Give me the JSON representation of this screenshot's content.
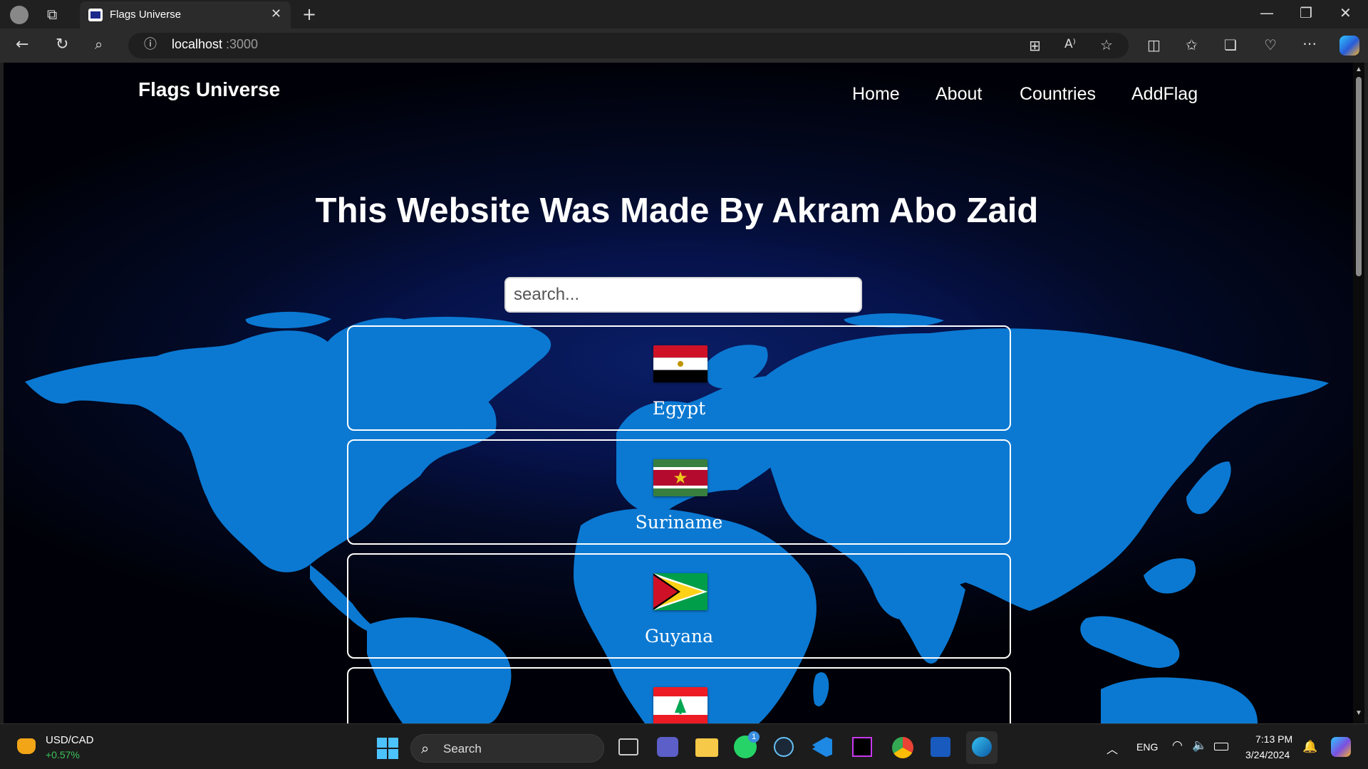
{
  "browser": {
    "tab_title": "Flags Universe",
    "url_host": "localhost",
    "url_port": ":3000"
  },
  "site": {
    "brand": "Flags Universe",
    "nav": [
      "Home",
      "About",
      "Countries",
      "AddFlag"
    ],
    "hero_title": "This Website Was Made By Akram Abo Zaid",
    "search_placeholder": "search..."
  },
  "countries": [
    {
      "name": "Egypt",
      "flag": "egypt-flag"
    },
    {
      "name": "Suriname",
      "flag": "suriname-flag"
    },
    {
      "name": "Guyana",
      "flag": "guyana-flag"
    },
    {
      "name": "",
      "flag": "lebanon-flag"
    }
  ],
  "taskbar": {
    "ticker_name": "USD/CAD",
    "ticker_change": "+0.57%",
    "search_label": "Search",
    "language": "ENG",
    "time": "7:13 PM",
    "date": "3/24/2024",
    "whatsapp_badge": "1"
  },
  "colors": {
    "map_blue": "#0b78d1",
    "background_navy": "#06124a",
    "ticker_green": "#3cc35a"
  }
}
